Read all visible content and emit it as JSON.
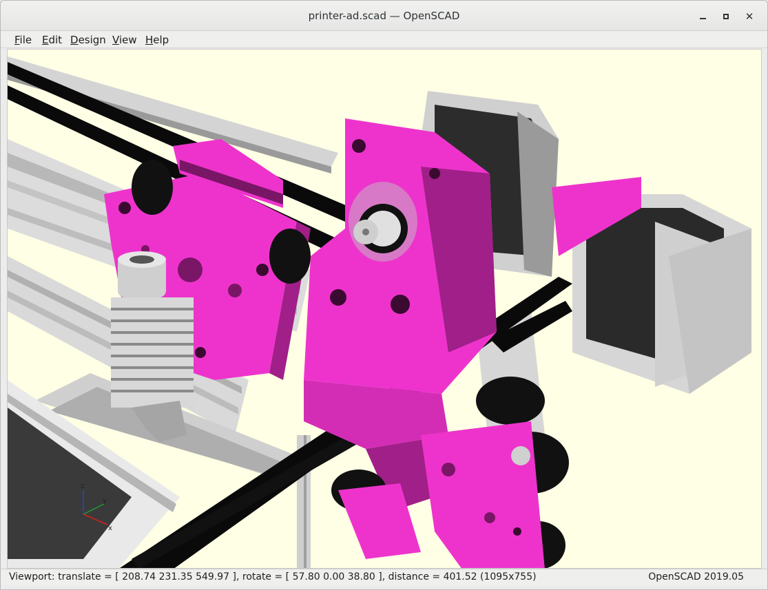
{
  "window": {
    "title": "printer-ad.scad — OpenSCAD",
    "controls": [
      "minimize",
      "maximize",
      "close"
    ]
  },
  "menu": {
    "file": {
      "accel": "F",
      "rest": "ile"
    },
    "edit": {
      "accel": "E",
      "rest": "dit"
    },
    "design": {
      "accel": "D",
      "rest": "esign"
    },
    "view": {
      "accel": "V",
      "rest": "iew"
    },
    "help": {
      "accel": "H",
      "rest": "elp"
    }
  },
  "viewport": {
    "background": "#ffffe5",
    "part_color": "#ee33cc",
    "axis_labels": {
      "x": "x",
      "y": "y",
      "z": "z"
    }
  },
  "status": {
    "viewport_text": "Viewport: translate = [ 208.74 231.35 549.97 ], rotate = [ 57.80 0.00 38.80 ], distance = 401.52 (1095x755)",
    "version": "OpenSCAD 2019.05"
  }
}
